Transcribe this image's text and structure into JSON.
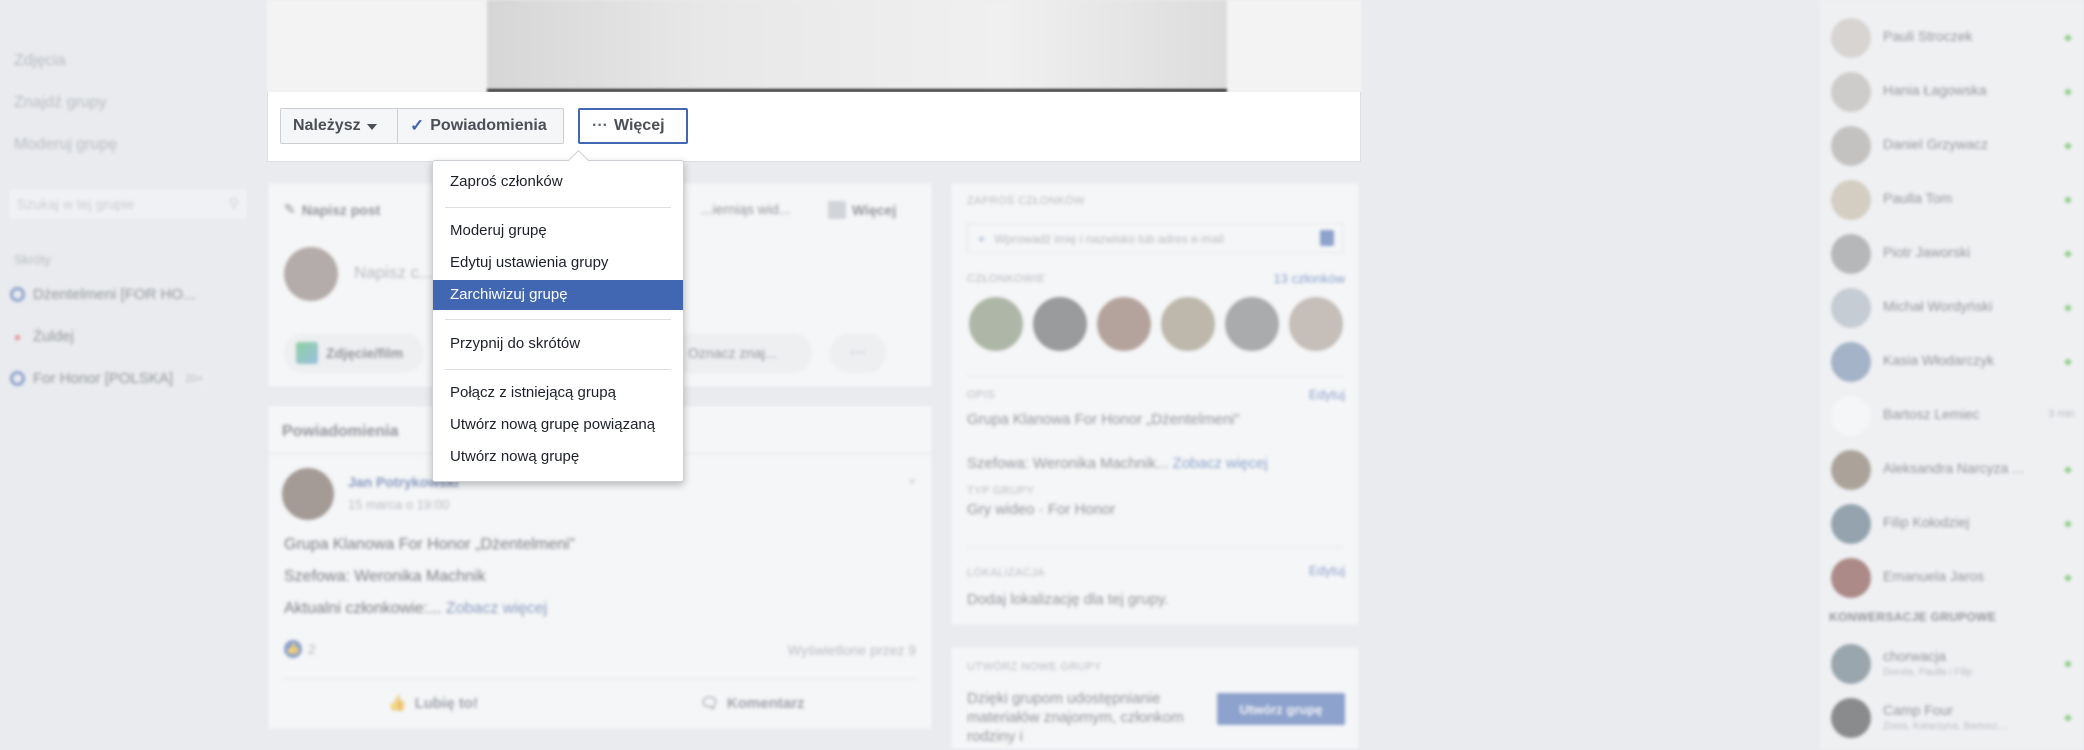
{
  "left_sidebar": {
    "nav": [
      "Zdjęcia",
      "Znajdź grupy",
      "Moderuj grupę"
    ],
    "search_placeholder": "Szukaj w tej grupie",
    "section_label": "Skróty",
    "shortcuts": [
      {
        "label": "Dżentelmeni [FOR HO...",
        "icon": "group-icon"
      },
      {
        "label": "Żuldej",
        "icon": "pin-icon"
      },
      {
        "label": "For Honor [POLSKA]",
        "icon": "group-icon",
        "badge": "20+"
      }
    ]
  },
  "action_bar": {
    "member_label": "Należysz",
    "notifications_label": "Powiadomienia",
    "more_label": "Więcej"
  },
  "menu": {
    "items": [
      "Zaproś członków",
      "Moderuj grupę",
      "Edytuj ustawienia grupy",
      "Zarchiwizuj grupę",
      "Przypnij do skrótów",
      "Połącz z istniejącą grupą",
      "Utwórz nową grupę powiązaną",
      "Utwórz nową grupę"
    ],
    "selected": "Zarchiwizuj grupę"
  },
  "composer": {
    "tab_write": "Napisz post",
    "tab_live": "...ierniąs wid...",
    "tab_more": "Więcej",
    "placeholder": "Napisz c...",
    "photo_label": "Zdjęcie/film",
    "tag_label": "Oznacz znaj...",
    "more_label": "···"
  },
  "post": {
    "header": "Powiadomienia",
    "author": "Jan Potrykowski",
    "date": "15 marca o 19:00",
    "lines": [
      "Grupa Klanowa For Honor „Dżentelmeni”",
      "Szefowa: Weronika Machnik",
      "Aktualni członkowie:..."
    ],
    "see_more": "Zobacz więcej",
    "likes": "2",
    "viewed": "Wyświetlone przez 9",
    "like_label": "Lubię to!",
    "comment_label": "Komentarz"
  },
  "members_card": {
    "invite_caption": "ZAPROŚ CZŁONKÓW",
    "invite_placeholder": "Wprowadź imię i nazwisko lub adres e-mail",
    "members_caption": "CZŁONKOWIE",
    "members_count": "13 członków",
    "description_caption": "OPIS",
    "description": "Grupa Klanowa For Honor „Dżentelmeni”",
    "leader": "Szefowa: Weronika Machnik...",
    "see_more": "Zobacz więcej",
    "type_caption": "TYP GRUPY",
    "type_value": "Gry wideo · For Honor",
    "location_caption": "LOKALIZACJA",
    "location_value": "Dodaj lokalizację dla tej grupy.",
    "edit_label": "Edytuj"
  },
  "create_card": {
    "caption": "UTWÓRZ NOWE GRUPY",
    "text": "Dzięki grupom udostępnianie materiałów znajomym, członkom rodziny i",
    "button": "Utwórz grupę"
  },
  "chat": {
    "contacts": [
      {
        "name": "Pauli Stroczek",
        "online": true
      },
      {
        "name": "Hania Łagowska",
        "online": true
      },
      {
        "name": "Daniel Grzywacz",
        "online": true
      },
      {
        "name": "Paulla Tom",
        "online": true
      },
      {
        "name": "Piotr Jaworski",
        "online": true
      },
      {
        "name": "Michał Wordyński",
        "online": true
      },
      {
        "name": "Kasia Włodarczyk",
        "online": true
      },
      {
        "name": "Bartosz Lemiec",
        "online": false,
        "time": "3 min"
      },
      {
        "name": "Aleksandra Narcyza ...",
        "online": true
      },
      {
        "name": "Filip Kołodziej",
        "online": true
      },
      {
        "name": "Emanuela Jaros",
        "online": true
      }
    ],
    "group_header": "KONWERSACJE GRUPOWE",
    "groups": [
      {
        "name": "chorwacja",
        "members": "Dorota, Paulla i Filip"
      },
      {
        "name": "Camp Four",
        "members": "Zosia, Katarzyna, Bartosz,..."
      }
    ]
  },
  "colors": {
    "accent": "#4267b2",
    "online": "#42b72a",
    "page_bg": "#e9ebee"
  }
}
